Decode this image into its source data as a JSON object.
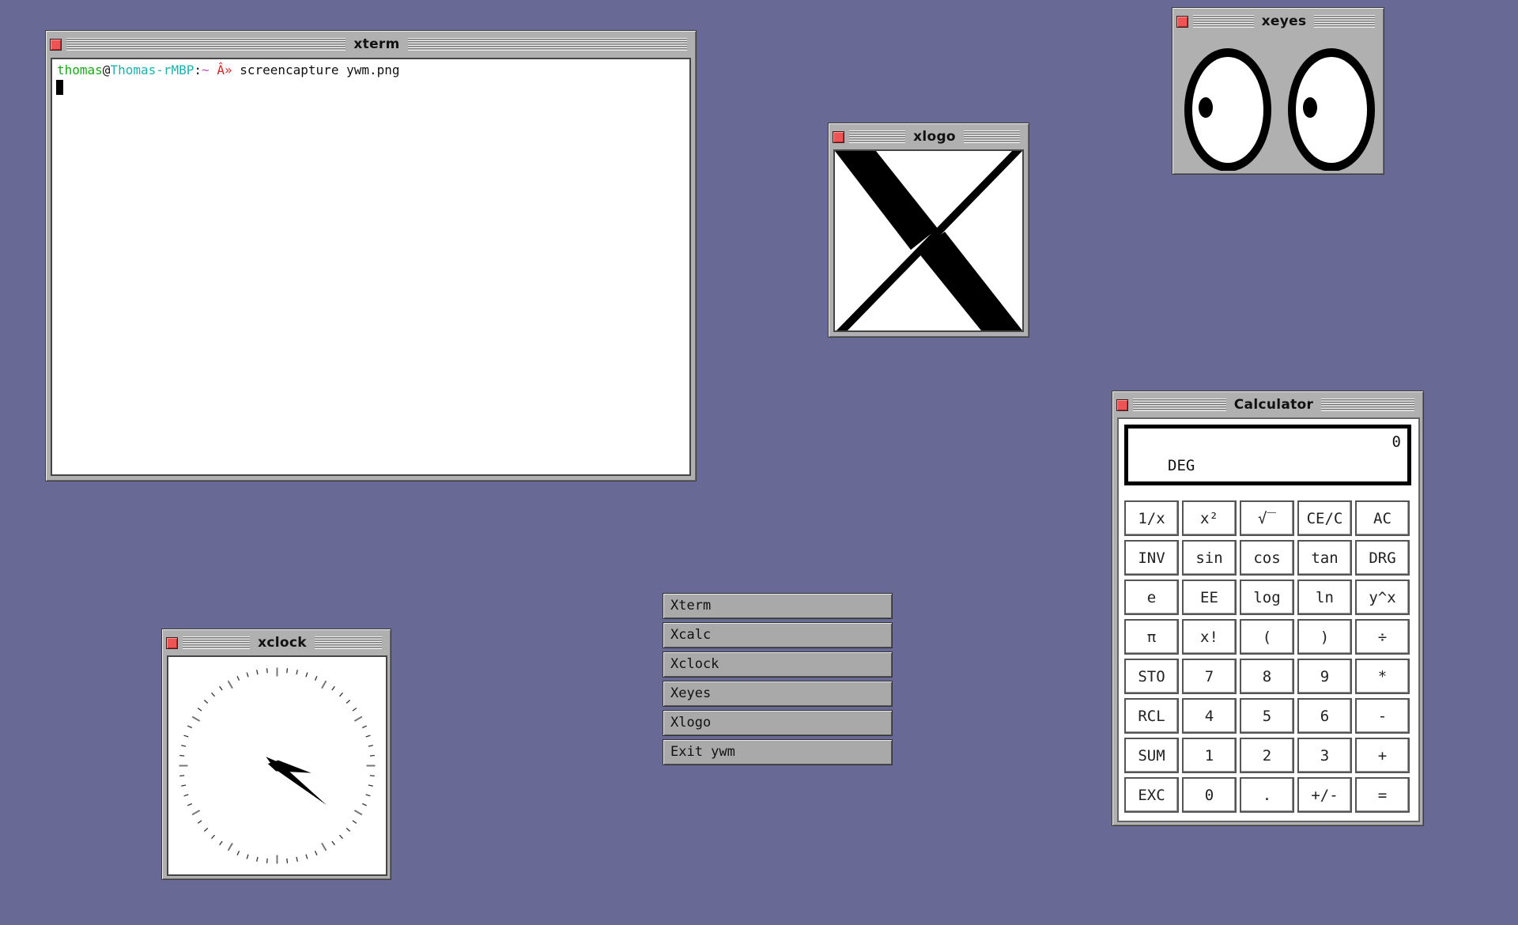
{
  "desktop": {
    "background_color": "#696996"
  },
  "windows": {
    "xterm": {
      "title": "xterm",
      "prompt_user": "thomas",
      "prompt_at": "@",
      "prompt_host": "Thomas-rMBP",
      "prompt_colon": ":",
      "prompt_path": "~",
      "prompt_arrow": " Â» ",
      "command": "screencapture ywm.png"
    },
    "xeyes": {
      "title": "xeyes"
    },
    "xlogo": {
      "title": "xlogo"
    },
    "xclock": {
      "title": "xclock",
      "time": {
        "hour": 4,
        "minute": 17
      }
    },
    "calculator": {
      "title": "Calculator",
      "display_value": "0",
      "display_mode": "DEG",
      "keys": [
        "1/x",
        "x²",
        "√‾",
        "CE/C",
        "AC",
        "INV",
        "sin",
        "cos",
        "tan",
        "DRG",
        "e",
        "EE",
        "log",
        "ln",
        "y^x",
        "π",
        "x!",
        "(",
        ")",
        "÷",
        "STO",
        "7",
        "8",
        "9",
        "*",
        "RCL",
        "4",
        "5",
        "6",
        "-",
        "SUM",
        "1",
        "2",
        "3",
        "+",
        "EXC",
        "0",
        ".",
        "+/-",
        "="
      ]
    }
  },
  "menu": {
    "items": [
      "Xterm",
      "Xcalc",
      "Xclock",
      "Xeyes",
      "Xlogo",
      "Exit ywm"
    ]
  }
}
